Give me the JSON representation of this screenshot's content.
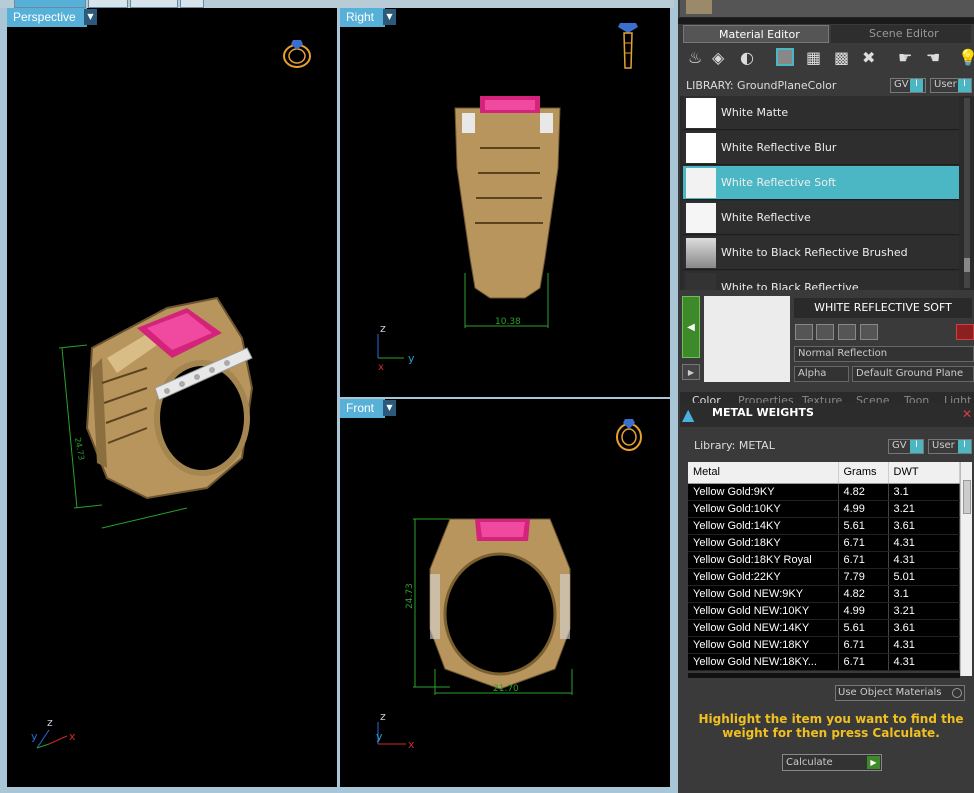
{
  "viewports": {
    "perspective": "Perspective",
    "right": "Right",
    "front": "Front",
    "tabs": [
      "Perspective",
      "Right",
      "Front",
      ""
    ]
  },
  "dims": {
    "right_width": "10.38",
    "front_width": "21.70",
    "front_height": "24.73",
    "persp_height": "24.73"
  },
  "axes": {
    "x": "x",
    "y": "y",
    "z": "z"
  },
  "material_editor": {
    "tab_material": "Material Editor",
    "tab_scene": "Scene Editor",
    "library_label": "LIBRARY: GroundPlaneColor",
    "gv": "GV",
    "user": "User",
    "items": [
      {
        "label": "White Matte",
        "color": "#ffffff"
      },
      {
        "label": "White Reflective Blur",
        "color": "#ffffff"
      },
      {
        "label": "White Reflective Soft",
        "color": "#f2f2f2"
      },
      {
        "label": "White Reflective",
        "color": "#f5f5f5"
      },
      {
        "label": "White to Black Reflective Brushed",
        "color": "#bdbdbd"
      },
      {
        "label": "White to Black Reflective",
        "color": "#333333"
      }
    ],
    "selected_title": "WHITE REFLECTIVE SOFT",
    "reflection_select": "Normal Reflection",
    "alpha_label": "Alpha",
    "ground_plane_select": "Default Ground Plane",
    "bottom_tabs": [
      "Color",
      "Properties",
      "Texture",
      "Scene",
      "Toon",
      "Light"
    ]
  },
  "metal_weights": {
    "title": "METAL WEIGHTS",
    "library_label": "Library: METAL",
    "gv": "GV",
    "user": "User",
    "headers": [
      "Metal",
      "Grams",
      "DWT"
    ],
    "rows": [
      [
        "Yellow Gold:9KY",
        "4.82",
        "3.1"
      ],
      [
        "Yellow Gold:10KY",
        "4.99",
        "3.21"
      ],
      [
        "Yellow Gold:14KY",
        "5.61",
        "3.61"
      ],
      [
        "Yellow Gold:18KY",
        "6.71",
        "4.31"
      ],
      [
        "Yellow Gold:18KY Royal",
        "6.71",
        "4.31"
      ],
      [
        "Yellow Gold:22KY",
        "7.79",
        "5.01"
      ],
      [
        "Yellow Gold NEW:9KY",
        "4.82",
        "3.1"
      ],
      [
        "Yellow Gold NEW:10KY",
        "4.99",
        "3.21"
      ],
      [
        "Yellow Gold NEW:14KY",
        "5.61",
        "3.61"
      ],
      [
        "Yellow Gold NEW:18KY",
        "6.71",
        "4.31"
      ],
      [
        "Yellow Gold NEW:18KY...",
        "6.71",
        "4.31"
      ]
    ],
    "use_object_materials": "Use Object Materials",
    "instruction": "Highlight the item you want to find the weight for then press Calculate.",
    "calculate_label": "Calculate"
  },
  "colors": {
    "accent": "#4bb7c4",
    "viewport_label": "#56b0d8",
    "gold": "#c8a66a",
    "ruby": "#d4237a",
    "instruction": "#f0c020"
  }
}
